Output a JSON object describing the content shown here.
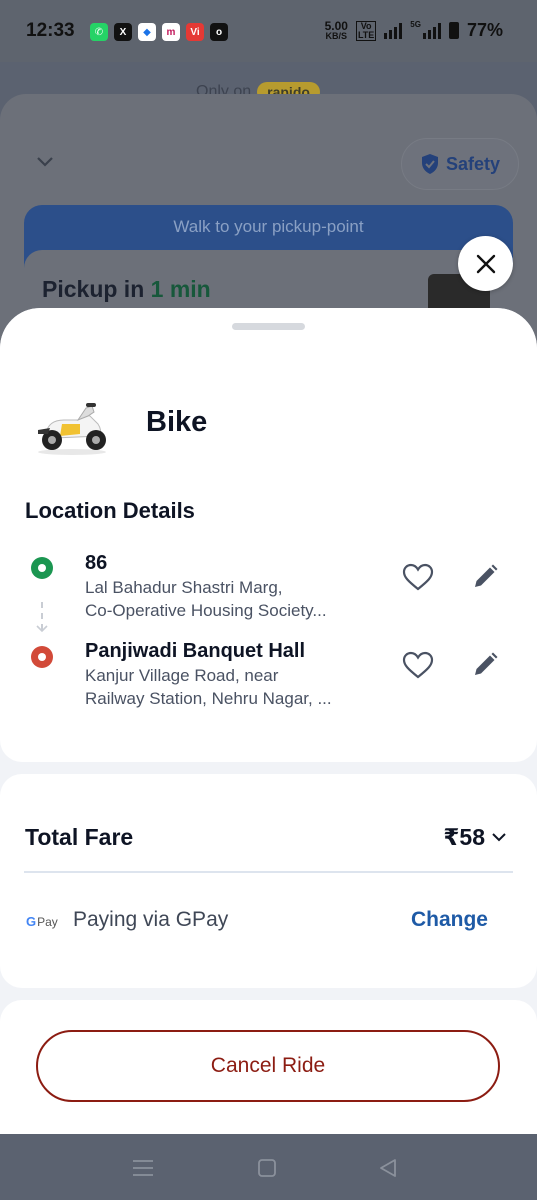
{
  "status_bar": {
    "time": "12:33",
    "net_speed_value": "5.00",
    "net_speed_unit": "KB/S",
    "volte_top": "Vo",
    "volte_bottom": "LTE",
    "network_type": "5G",
    "battery": "77%",
    "notification_icons": [
      "whatsapp-icon",
      "x-icon",
      "files-icon",
      "myntra-icon",
      "vi-icon",
      "ola-icon"
    ]
  },
  "background": {
    "only_on_prefix": "Only on",
    "brand": "rapido",
    "safety_label": "Safety",
    "walk_banner": "Walk to your pickup-point",
    "pickup_prefix": "Pickup in",
    "pickup_time": "1 min"
  },
  "ride": {
    "vehicle": "Bike",
    "location_title": "Location Details",
    "pickup": {
      "name": "86",
      "address_line1": "Lal Bahadur Shastri Marg,",
      "address_line2": "Co-Operative Housing Society..."
    },
    "drop": {
      "name": "Panjiwadi Banquet Hall",
      "address_line1": "Kanjur Village Road, near",
      "address_line2": "Railway Station, Nehru Nagar, ..."
    }
  },
  "fare": {
    "label": "Total Fare",
    "amount": "₹58",
    "payment_logo_g": "G",
    "payment_logo_pay": "Pay",
    "payment_text": "Paying via GPay",
    "change_label": "Change"
  },
  "actions": {
    "cancel_label": "Cancel Ride"
  },
  "colors": {
    "accent_blue": "#1e5aa6",
    "cancel_red": "#8c1c12",
    "pickup_green": "#1b9651",
    "drop_red": "#d24a39"
  }
}
